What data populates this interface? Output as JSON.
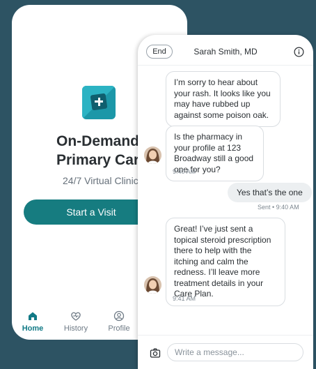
{
  "home": {
    "title_line1": "On-Demand",
    "title_line2": "Primary Care",
    "subtitle": "24/7 Virtual Clinic",
    "start_button": "Start a Visit",
    "tabs": [
      {
        "label": "Home",
        "icon": "home-icon",
        "active": true
      },
      {
        "label": "History",
        "icon": "history-icon",
        "active": false
      },
      {
        "label": "Profile",
        "icon": "profile-icon",
        "active": false
      }
    ]
  },
  "chat": {
    "end_label": "End",
    "doctor_name": "Sarah Smith, MD",
    "messages": [
      {
        "from": "doctor",
        "text": "I’m sorry to hear about your rash. It looks like you may have rubbed up against some poison oak."
      },
      {
        "from": "doctor",
        "text": "Is the pharmacy in your profile at 123 Broadway still a good one for you?",
        "time": "9:40 AM"
      },
      {
        "from": "patient",
        "text": "Yes that’s the one",
        "time": "Sent • 9:40 AM"
      },
      {
        "from": "doctor",
        "text": "Great! I’ve just sent a topical steroid prescription there to help with the itching and calm the redness. I’ll leave more treatment details in your Care Plan.",
        "time": "9:41 AM"
      }
    ],
    "input_placeholder": "Write a message..."
  },
  "colors": {
    "background": "#2d5363",
    "accent": "#167c80",
    "active_tab": "#127a86"
  }
}
